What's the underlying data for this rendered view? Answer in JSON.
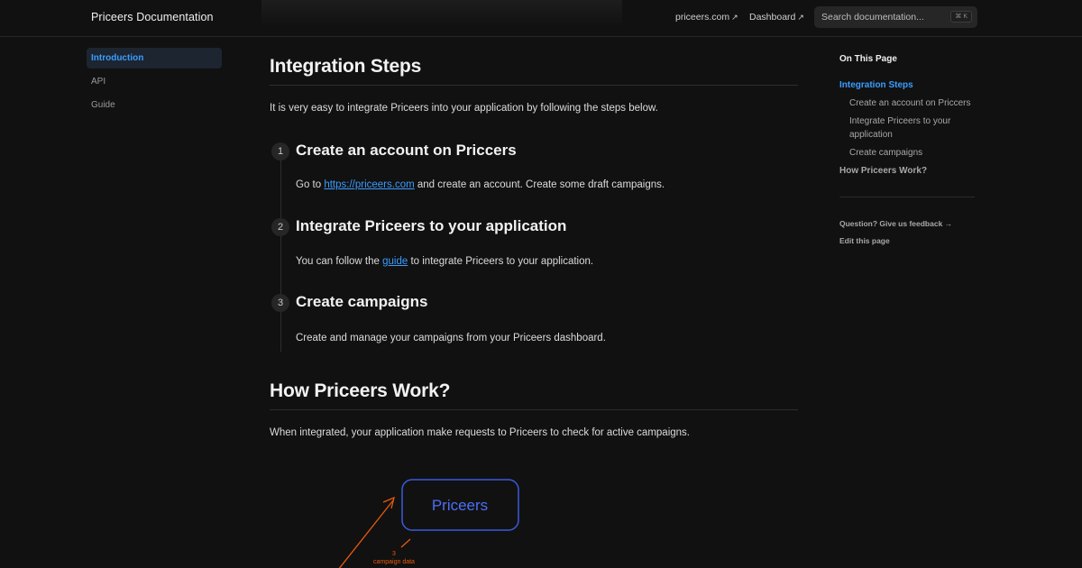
{
  "navbar": {
    "logo": "Priceers Documentation",
    "links": [
      {
        "label": "priceers.com",
        "arrow": "↗"
      },
      {
        "label": "Dashboard",
        "arrow": "↗"
      }
    ],
    "search": {
      "placeholder": "Search documentation...",
      "shortcut": "⌘ K"
    }
  },
  "sidebar": {
    "items": [
      {
        "label": "Introduction",
        "active": true
      },
      {
        "label": "API",
        "active": false
      },
      {
        "label": "Guide",
        "active": false
      }
    ]
  },
  "content": {
    "integration": {
      "title": "Integration Steps",
      "intro": "It is very easy to integrate Priceers into your application by following the steps below."
    },
    "steps": [
      {
        "num": "1",
        "title": "Create an account on Priccers",
        "pre": "Go to ",
        "link": "https://priceers.com",
        "post": " and create an account. Create some draft campaigns."
      },
      {
        "num": "2",
        "title": "Integrate Priceers to your application",
        "pre": "You can follow the ",
        "link": "guide",
        "post": " to integrate Priceers to your application."
      },
      {
        "num": "3",
        "title": "Create campaigns",
        "text": "Create and manage your campaigns from your Priceers dashboard."
      }
    ],
    "how": {
      "title": "How Priceers Work?",
      "intro": "When integrated, your application make requests to Priceers to check for active campaigns."
    },
    "diagram": {
      "box_label": "Priceers",
      "note_num": "3",
      "note_text": "campaign data",
      "box_color": "#3b5bdb",
      "arrow_color": "#e8590c"
    }
  },
  "toc": {
    "title": "On This Page",
    "items": [
      {
        "label": "Integration Steps",
        "level": 1,
        "active": true
      },
      {
        "label": "Create an account on Priccers",
        "level": 2
      },
      {
        "label": "Integrate Priceers to your application",
        "level": 2
      },
      {
        "label": "Create campaigns",
        "level": 2
      },
      {
        "label": "How Priceers Work?",
        "level": 1
      }
    ],
    "feedback": "Question? Give us feedback →",
    "edit": "Edit this page"
  }
}
